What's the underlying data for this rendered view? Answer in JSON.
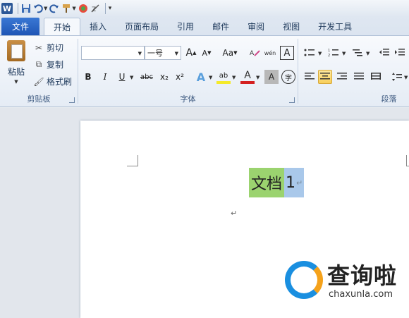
{
  "qat": {
    "app_icon": "W",
    "icons": [
      "save-icon",
      "undo-icon",
      "redo-icon",
      "format-painter-icon",
      "color-icon",
      "clear-format-icon",
      "customize-icon"
    ]
  },
  "tabs": {
    "file": "文件",
    "items": [
      "开始",
      "插入",
      "页面布局",
      "引用",
      "邮件",
      "审阅",
      "视图",
      "开发工具"
    ],
    "active_index": 0
  },
  "clipboard": {
    "paste_label": "粘贴",
    "cut_label": "剪切",
    "copy_label": "复制",
    "format_painter_label": "格式刷",
    "group_label": "剪贴板"
  },
  "font": {
    "font_name": "",
    "font_size": "一号",
    "grow_label": "A",
    "shrink_label": "A",
    "case_label": "Aa",
    "pinyin_label": "wén",
    "border_label": "A",
    "bold_label": "B",
    "italic_label": "I",
    "underline_label": "U",
    "strike_label": "abc",
    "subscript_label": "x₂",
    "superscript_label": "x²",
    "text_effect_label": "A",
    "highlight_label": "ab",
    "font_color_label": "A",
    "char_shading_label": "A",
    "enclose_label": "字",
    "group_label": "字体"
  },
  "paragraph": {
    "group_label": "段落"
  },
  "document": {
    "text_green": "文档",
    "text_selected": "1",
    "para_mark": "↵"
  },
  "watermark": {
    "title": "查询啦",
    "subtitle": "chaxunla.com"
  },
  "colors": {
    "file_tab": "#2b62c4",
    "highlight_green": "#9bd36f",
    "selection": "#a9c8ea",
    "watermark_blue": "#1a8fe0",
    "watermark_orange": "#f5a21b"
  }
}
